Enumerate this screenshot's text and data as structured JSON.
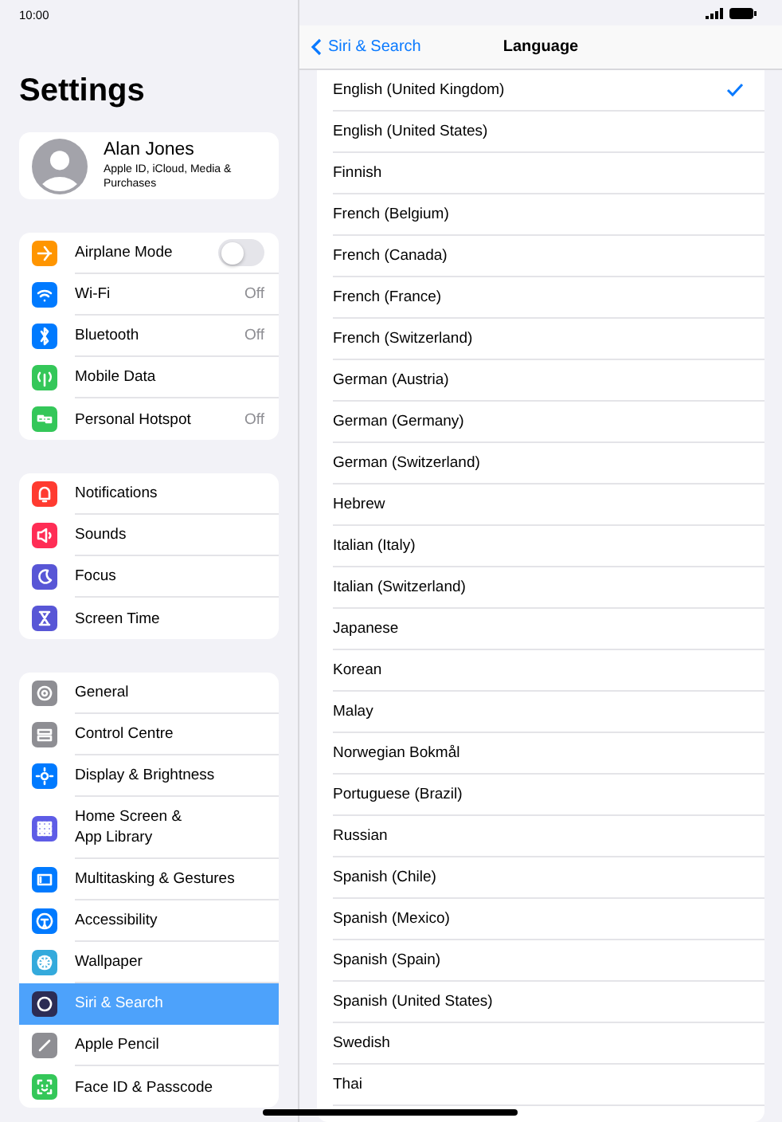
{
  "status_bar": {
    "time": "10:00"
  },
  "sidebar": {
    "title": "Settings",
    "profile": {
      "name": "Alan Jones",
      "subtitle": "Apple ID, iCloud, Media & Purchases"
    },
    "groups": [
      {
        "items": [
          {
            "label": "Airplane Mode",
            "kind": "toggle",
            "on": false,
            "color": "#ff9500",
            "selected": false
          },
          {
            "label": "Wi-Fi",
            "kind": "value",
            "value": "Off",
            "color": "#007aff",
            "selected": false
          },
          {
            "label": "Bluetooth",
            "kind": "value",
            "value": "Off",
            "color": "#007aff",
            "selected": false
          },
          {
            "label": "Mobile Data",
            "kind": "plain",
            "color": "#34c759",
            "selected": false
          },
          {
            "label": "Personal Hotspot",
            "kind": "value",
            "value": "Off",
            "color": "#34c759",
            "selected": false
          }
        ]
      },
      {
        "items": [
          {
            "label": "Notifications",
            "kind": "plain",
            "color": "#ff3b30",
            "selected": false
          },
          {
            "label": "Sounds",
            "kind": "plain",
            "color": "#ff2d55",
            "selected": false
          },
          {
            "label": "Focus",
            "kind": "plain",
            "color": "#5856d6",
            "selected": false
          },
          {
            "label": "Screen Time",
            "kind": "plain",
            "color": "#5856d6",
            "selected": false
          }
        ]
      },
      {
        "items": [
          {
            "label": "General",
            "kind": "plain",
            "color": "#8e8e93",
            "selected": false
          },
          {
            "label": "Control Centre",
            "kind": "plain",
            "color": "#8e8e93",
            "selected": false
          },
          {
            "label": "Display & Brightness",
            "kind": "plain",
            "color": "#007aff",
            "selected": false
          },
          {
            "label": "Home Screen & App Library",
            "kind": "plain",
            "color": "#5e5ce6",
            "selected": false
          },
          {
            "label": "Multitasking & Gestures",
            "kind": "plain",
            "color": "#007aff",
            "selected": false
          },
          {
            "label": "Accessibility",
            "kind": "plain",
            "color": "#007aff",
            "selected": false
          },
          {
            "label": "Wallpaper",
            "kind": "plain",
            "color": "#34aadc",
            "selected": false
          },
          {
            "label": "Siri & Search",
            "kind": "plain",
            "color": "#2c2c54",
            "selected": true
          },
          {
            "label": "Apple Pencil",
            "kind": "plain",
            "color": "#8e8e93",
            "selected": false
          },
          {
            "label": "Face ID & Passcode",
            "kind": "plain",
            "color": "#34c759",
            "selected": false
          }
        ]
      }
    ]
  },
  "detail": {
    "back": "Siri & Search",
    "title": "Language",
    "languages": [
      {
        "label": "English (United Kingdom)",
        "checked": true
      },
      {
        "label": "English (United States)",
        "checked": false
      },
      {
        "label": "Finnish",
        "checked": false
      },
      {
        "label": "French (Belgium)",
        "checked": false
      },
      {
        "label": "French (Canada)",
        "checked": false
      },
      {
        "label": "French (France)",
        "checked": false
      },
      {
        "label": "French (Switzerland)",
        "checked": false
      },
      {
        "label": "German (Austria)",
        "checked": false
      },
      {
        "label": "German (Germany)",
        "checked": false
      },
      {
        "label": "German (Switzerland)",
        "checked": false
      },
      {
        "label": "Hebrew",
        "checked": false
      },
      {
        "label": "Italian (Italy)",
        "checked": false
      },
      {
        "label": "Italian (Switzerland)",
        "checked": false
      },
      {
        "label": "Japanese",
        "checked": false
      },
      {
        "label": "Korean",
        "checked": false
      },
      {
        "label": "Malay",
        "checked": false
      },
      {
        "label": "Norwegian Bokmål",
        "checked": false
      },
      {
        "label": "Portuguese (Brazil)",
        "checked": false
      },
      {
        "label": "Russian",
        "checked": false
      },
      {
        "label": "Spanish (Chile)",
        "checked": false
      },
      {
        "label": "Spanish (Mexico)",
        "checked": false
      },
      {
        "label": "Spanish (Spain)",
        "checked": false
      },
      {
        "label": "Spanish (United States)",
        "checked": false
      },
      {
        "label": "Swedish",
        "checked": false
      },
      {
        "label": "Thai",
        "checked": false
      }
    ]
  }
}
